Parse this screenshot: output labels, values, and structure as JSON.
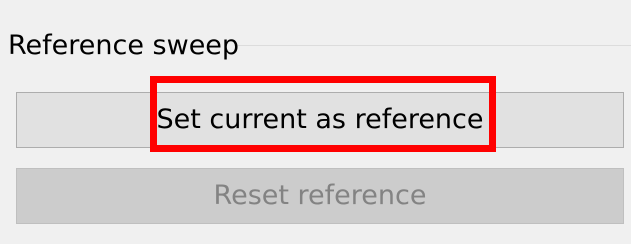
{
  "group": {
    "title": "Reference sweep"
  },
  "buttons": {
    "set_reference_label": "Set current as reference",
    "reset_reference_label": "Reset reference",
    "reset_enabled": false
  },
  "annotation": {
    "highlight_color": "#ff0000",
    "highlighted_element": "set-reference-button"
  }
}
